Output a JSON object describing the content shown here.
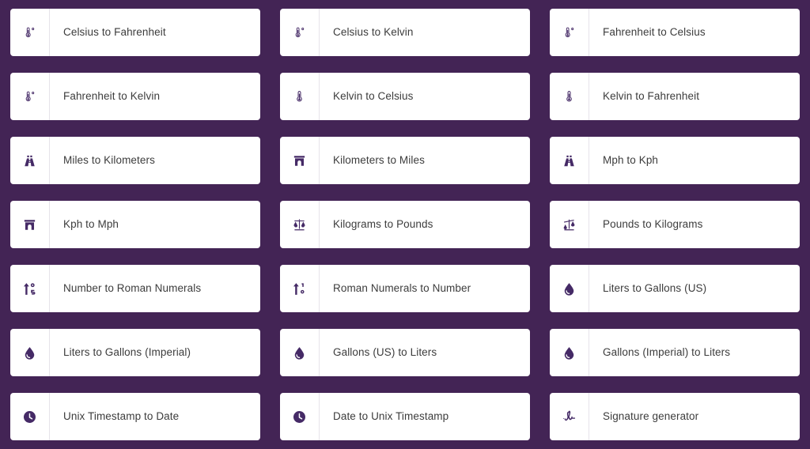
{
  "theme": {
    "background": "#432455",
    "card_background": "#ffffff",
    "icon_color": "#452a66",
    "label_color": "#3c3c3c",
    "divider_color": "#e6e3ea"
  },
  "grid": {
    "columns": 3,
    "rows": 7,
    "items": [
      {
        "label": "Celsius to Fahrenheit",
        "icon": "thermometer-degrees-icon"
      },
      {
        "label": "Celsius to Kelvin",
        "icon": "thermometer-degrees-icon"
      },
      {
        "label": "Fahrenheit to Celsius",
        "icon": "thermometer-degrees-icon"
      },
      {
        "label": "Fahrenheit to Kelvin",
        "icon": "thermometer-degrees-icon"
      },
      {
        "label": "Kelvin to Celsius",
        "icon": "thermometer-icon"
      },
      {
        "label": "Kelvin to Fahrenheit",
        "icon": "thermometer-icon"
      },
      {
        "label": "Miles to Kilometers",
        "icon": "road-icon"
      },
      {
        "label": "Kilometers to Miles",
        "icon": "tunnel-icon"
      },
      {
        "label": "Mph to Kph",
        "icon": "road-icon"
      },
      {
        "label": "Kph to Mph",
        "icon": "tunnel-icon"
      },
      {
        "label": "Kilograms to Pounds",
        "icon": "balance-scale-icon"
      },
      {
        "label": "Pounds to Kilograms",
        "icon": "balance-scale-tilted-icon"
      },
      {
        "label": "Number to Roman Numerals",
        "icon": "sort-numeric-up-icon"
      },
      {
        "label": "Roman Numerals to Number",
        "icon": "sort-numeric-down-icon"
      },
      {
        "label": "Liters to Gallons (US)",
        "icon": "droplet-icon"
      },
      {
        "label": "Liters to Gallons (Imperial)",
        "icon": "droplet-icon"
      },
      {
        "label": "Gallons (US) to Liters",
        "icon": "droplet-icon"
      },
      {
        "label": "Gallons (Imperial) to Liters",
        "icon": "droplet-icon"
      },
      {
        "label": "Unix Timestamp to Date",
        "icon": "clock-icon"
      },
      {
        "label": "Date to Unix Timestamp",
        "icon": "clock-icon"
      },
      {
        "label": "Signature generator",
        "icon": "signature-icon"
      }
    ]
  }
}
